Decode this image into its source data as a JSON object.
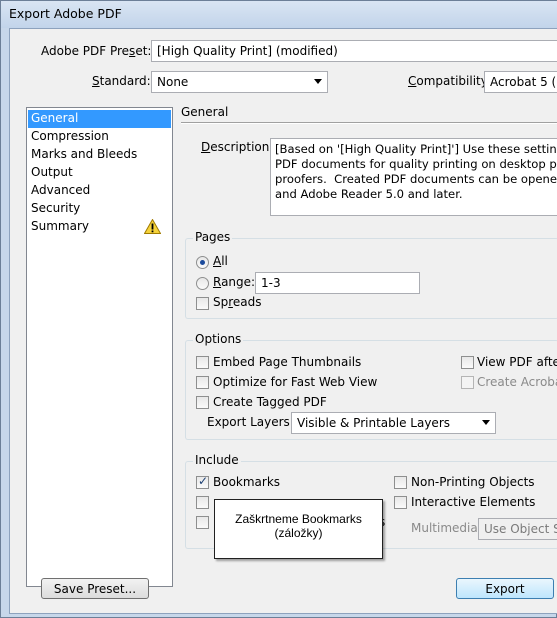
{
  "window": {
    "title": "Export Adobe PDF"
  },
  "preset": {
    "label": "Adobe PDF Preset:",
    "label_pre": "Adobe PDF Pre",
    "label_u": "s",
    "label_post": "et:",
    "value": "[High Quality Print] (modified)"
  },
  "standard": {
    "label": "Standard:",
    "label_u": "S",
    "label_post": "tandard:",
    "value": "None"
  },
  "compatibility": {
    "label": "Compatibility:",
    "label_u": "C",
    "label_post": "ompatibility:",
    "value": "Acrobat 5 (P"
  },
  "sidebar": {
    "items": [
      {
        "label": "General",
        "selected": true
      },
      {
        "label": "Compression"
      },
      {
        "label": "Marks and Bleeds"
      },
      {
        "label": "Output"
      },
      {
        "label": "Advanced"
      },
      {
        "label": "Security"
      },
      {
        "label": "Summary",
        "icon": "warning-icon"
      }
    ]
  },
  "panel": {
    "title": "General",
    "description_label": "Description:",
    "description_label_u": "D",
    "description_label_post": "escription:",
    "description_lines": [
      "[Based on '[High Quality Print]'] Use these settings",
      "PDF documents for quality printing on desktop print",
      "proofers.  Created PDF documents can be opened w",
      "and Adobe Reader 5.0 and later."
    ]
  },
  "pages": {
    "title": "Pages",
    "all_label": "All",
    "all_u": "A",
    "all_post": "ll",
    "range_label": "Range:",
    "range_u": "R",
    "range_post": "ange:",
    "range_value": "1-3",
    "spreads_label": "Spreads",
    "spreads_pre": "Sp",
    "spreads_u": "r",
    "spreads_post": "eads"
  },
  "options": {
    "title": "Options",
    "embed_thumbnails": "Embed Page Thumbnails",
    "optimize_web": "Optimize for Fast Web View",
    "tagged_pdf": "Create Tagged PDF",
    "view_pdf": "View PDF after",
    "create_acrobat": "Create Acrobat",
    "export_layers_label": "Export Layers:",
    "export_layers_value": "Visible & Printable Layers"
  },
  "include": {
    "title": "Include",
    "bookmarks": "Bookmarks",
    "bookmarks_checked": true,
    "non_printing": "Non-Printing Objects",
    "interactive": "Interactive Elements",
    "multimedia_label": "Multimedia:",
    "multimedia_value": "Use Object Se",
    "hidden_label_fragment": "s"
  },
  "tooltip": {
    "line1": "Zaškrtneme Bookmarks",
    "line2": "(záložky)"
  },
  "buttons": {
    "save_preset": "Save Preset...",
    "export": "Export"
  }
}
